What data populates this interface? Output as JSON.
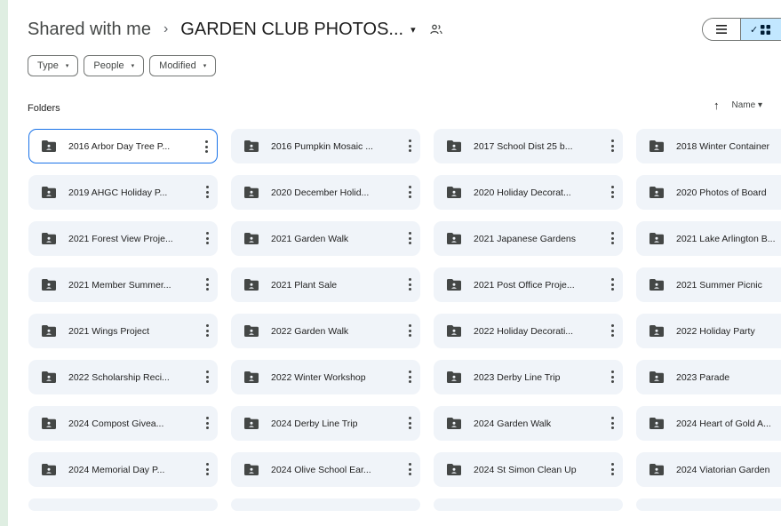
{
  "breadcrumb": {
    "root": "Shared with me",
    "separator": "›",
    "current": "GARDEN CLUB PHOTOS...",
    "caret": "▾"
  },
  "view_toggle": {
    "list_icon": "list-icon",
    "grid_check": "✓",
    "grid_icon": "grid-icon",
    "selected": "grid"
  },
  "filters": [
    {
      "label": "Type",
      "caret": "▾"
    },
    {
      "label": "People",
      "caret": "▾"
    },
    {
      "label": "Modified",
      "caret": "▾"
    }
  ],
  "section_label": "Folders",
  "sort": {
    "arrow": "↑",
    "label": "Name",
    "caret": "▾"
  },
  "colors": {
    "accent": "#1a73e8",
    "folder_bg": "#f0f4f9",
    "toggle_selected": "#c2e7ff",
    "outer_bg": "#dfeee2"
  },
  "folders": [
    "2016 Arbor Day Tree P...",
    "2016 Pumpkin Mosaic ...",
    "2017 School Dist 25 b...",
    "2018 Winter Container",
    "2019 AHGC Holiday P...",
    "2020 December Holid...",
    "2020 Holiday Decorat...",
    "2020 Photos of Board",
    "2021 Forest View Proje...",
    "2021 Garden Walk",
    "2021 Japanese Gardens",
    "2021 Lake Arlington B...",
    "2021 Member Summer...",
    "2021 Plant Sale",
    "2021 Post Office Proje...",
    "2021 Summer Picnic",
    "2021 Wings Project",
    "2022 Garden Walk",
    "2022 Holiday Decorati...",
    "2022 Holiday Party",
    "2022 Scholarship Reci...",
    "2022 Winter Workshop",
    "2023 Derby Line Trip",
    "2023 Parade",
    "2024 Compost Givea...",
    "2024 Derby Line Trip",
    "2024 Garden Walk",
    "2024 Heart of Gold A...",
    "2024 Memorial Day P...",
    "2024 Olive School Ear...",
    "2024 St Simon Clean Up",
    "2024 Viatorian Garden"
  ]
}
